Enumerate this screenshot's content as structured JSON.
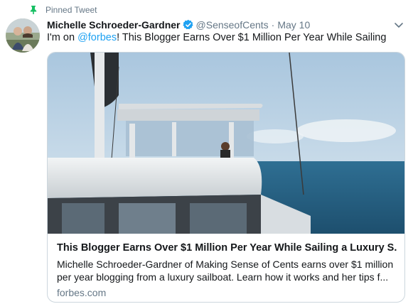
{
  "pinned": {
    "label": "Pinned Tweet",
    "icon": "pin-icon"
  },
  "author": {
    "display_name": "Michelle Schroeder-Gardner",
    "handle": "@SenseofCents",
    "separator": "·",
    "date": "May 10",
    "verified": true
  },
  "tweet": {
    "text_before": "I'm on ",
    "mention": "@forbes",
    "text_after": "! This Blogger Earns Over $1 Million Per Year While Sailing"
  },
  "card": {
    "title": "This Blogger Earns Over $1 Million Per Year While Sailing a Luxury S...",
    "description_line1": "Michelle Schroeder-Gardner of Making Sense of Cents earns over $1 million",
    "description_line2": "per year blogging from a luxury sailboat. Learn how it works and her tips f...",
    "domain": "forbes.com"
  },
  "colors": {
    "accent": "#1da1f2",
    "muted": "#657786",
    "pin_green": "#17bf63",
    "border": "#ccd6dd"
  }
}
